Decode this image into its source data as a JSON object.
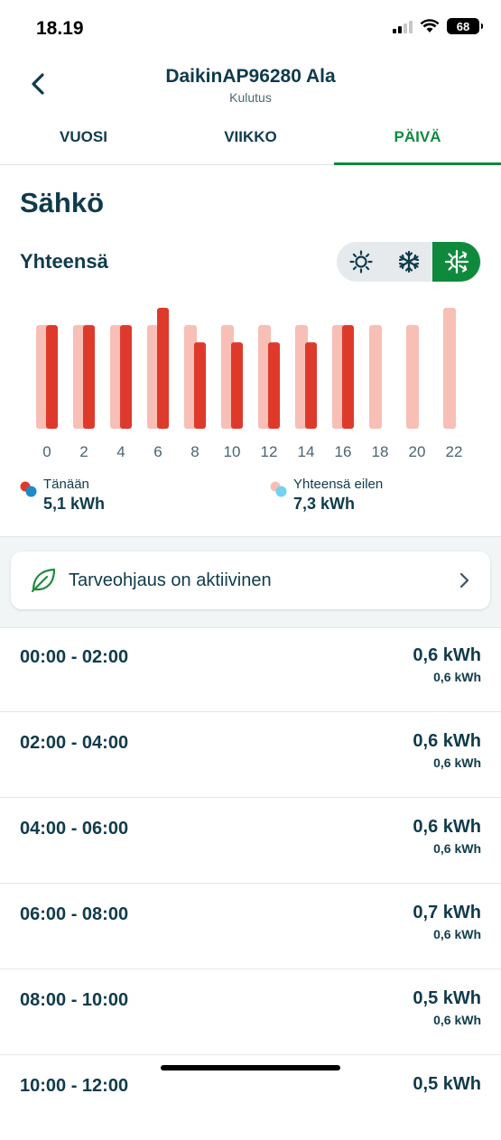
{
  "status_bar": {
    "time": "18.19",
    "battery": "68"
  },
  "header": {
    "title": "DaikinAP96280 Ala",
    "subtitle": "Kulutus"
  },
  "tabs": [
    {
      "label": "VUOSI",
      "active": false
    },
    {
      "label": "VIIKKO",
      "active": false
    },
    {
      "label": "PÄIVÄ",
      "active": true
    }
  ],
  "section": {
    "title": "Sähkö",
    "total_label": "Yhteensä"
  },
  "modes": [
    {
      "icon": "sun-icon",
      "active": false
    },
    {
      "icon": "snowflake-icon",
      "active": false
    },
    {
      "icon": "heat-cool-icon",
      "active": true
    }
  ],
  "chart_data": {
    "type": "bar",
    "categories": [
      "0",
      "2",
      "4",
      "6",
      "8",
      "10",
      "12",
      "14",
      "16",
      "18",
      "20",
      "22"
    ],
    "series": [
      {
        "name": "Yhteensä eilen",
        "color": "#f8bfb6",
        "values": [
          0.6,
          0.6,
          0.6,
          0.6,
          0.6,
          0.6,
          0.6,
          0.6,
          0.6,
          0.6,
          0.6,
          0.7
        ]
      },
      {
        "name": "Tänään",
        "color": "#de3a2c",
        "values": [
          0.6,
          0.6,
          0.6,
          0.7,
          0.5,
          0.5,
          0.5,
          0.5,
          0.6,
          null,
          null,
          null
        ]
      }
    ],
    "ylim": [
      0,
      0.7
    ]
  },
  "legend": {
    "today": {
      "label": "Tänään",
      "value": "5,1 kWh"
    },
    "yesterday": {
      "label": "Yhteensä eilen",
      "value": "7,3 kWh"
    }
  },
  "demand_card": {
    "label": "Tarveohjaus on aktiivinen"
  },
  "rows": [
    {
      "range": "00:00 - 02:00",
      "value": "0,6 kWh",
      "previous": "0,6 kWh"
    },
    {
      "range": "02:00 - 04:00",
      "value": "0,6 kWh",
      "previous": "0,6 kWh"
    },
    {
      "range": "04:00 - 06:00",
      "value": "0,6 kWh",
      "previous": "0,6 kWh"
    },
    {
      "range": "06:00 - 08:00",
      "value": "0,7 kWh",
      "previous": "0,6 kWh"
    },
    {
      "range": "08:00 - 10:00",
      "value": "0,5 kWh",
      "previous": "0,6 kWh"
    },
    {
      "range": "10:00 - 12:00",
      "value": "0,5 kWh",
      "previous": ""
    }
  ]
}
